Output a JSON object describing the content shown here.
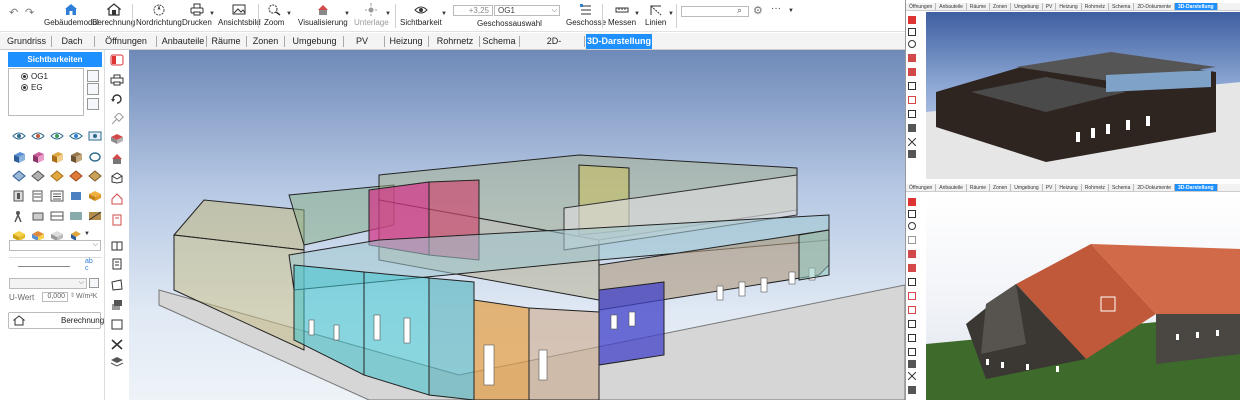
{
  "ribbon": {
    "buttons": [
      {
        "id": "gebaeudemodul",
        "label": "Gebäudemodul",
        "icon": "home-icon"
      },
      {
        "id": "berechnung",
        "label": "Berechnung",
        "icon": "calculator-house-icon"
      },
      {
        "id": "nordrichtung",
        "label": "Nordrichtung",
        "icon": "compass-icon"
      },
      {
        "id": "drucken",
        "label": "Drucken",
        "icon": "printer-icon"
      },
      {
        "id": "ansichtsbild",
        "label": "Ansichtsbild",
        "icon": "picture-icon"
      },
      {
        "id": "zoom",
        "label": "Zoom",
        "icon": "zoom-icon"
      },
      {
        "id": "visualisierung",
        "label": "Visualisierung",
        "icon": "house-render-icon"
      },
      {
        "id": "unterlage",
        "label": "Unterlage",
        "icon": "sun-icon",
        "disabled": true
      },
      {
        "id": "sichtbarkeit",
        "label": "Sichtbarkeit",
        "icon": "eye-icon"
      },
      {
        "id": "geschossauswahl",
        "label": "Geschossauswahl",
        "icon": "floor-select-icon"
      },
      {
        "id": "geschosse",
        "label": "Geschosse",
        "icon": "floors-icon"
      },
      {
        "id": "messen",
        "label": "Messen",
        "icon": "ruler-icon"
      },
      {
        "id": "linien",
        "label": "Linien",
        "icon": "lines-icon"
      }
    ],
    "elevation_value": "+3,25",
    "floor_value": "OG1",
    "search_placeholder": ""
  },
  "tabs": [
    "Grundriss",
    "Dach",
    "Öffnungen",
    "Anbauteile",
    "Räume",
    "Zonen",
    "Umgebung",
    "PV",
    "Heizung",
    "Rohrnetz",
    "Schema",
    "2D-Dokumente",
    "3D-Darstellung"
  ],
  "active_tab": "3D-Darstellung",
  "left_panel": {
    "header": "Sichtbarkeiten",
    "floors": [
      "OG1",
      "EG"
    ],
    "uwert_label": "U-Wert",
    "uwert_value": "0,000",
    "uwert_unit": "W/m²K",
    "calc_button": "Berechnung"
  },
  "mini_views": {
    "tabs": [
      "Öffnungen",
      "Anbauteile",
      "Räume",
      "Zonen",
      "Umgebung",
      "PV",
      "Heizung",
      "Rohrnetz",
      "Schema",
      "2D-Dokumente",
      "3D-Darstellung"
    ],
    "top_tabs": [
      "Öffnungen",
      "Anbauteile",
      "Räume",
      "Zonen",
      "Umgebung",
      "PV",
      "Heizung",
      "Rohrnetz",
      "Schema",
      "2D-Dokumente",
      "3D-Darstellung"
    ]
  },
  "colors": {
    "accent": "#1e90ff",
    "sky_top": "#6f8ab8",
    "sky_bottom": "#eef3f8",
    "grass": "#3e6b2c",
    "roof_red": "#c0583a"
  }
}
